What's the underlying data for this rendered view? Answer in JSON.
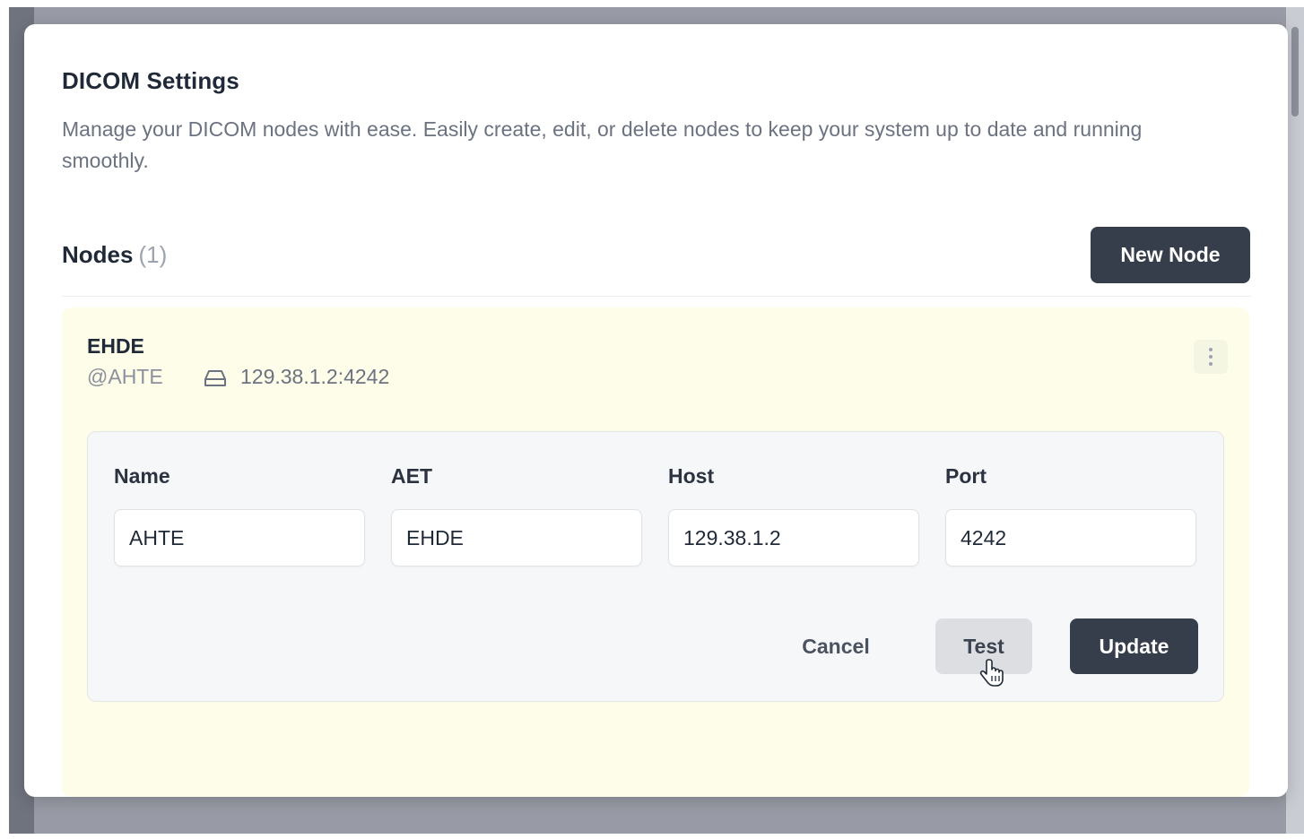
{
  "dialog": {
    "title": "DICOM Settings",
    "description": "Manage your DICOM nodes with ease. Easily create, edit, or delete nodes to keep your system up to date and running smoothly."
  },
  "nodes_section": {
    "heading": "Nodes",
    "count": "(1)",
    "new_button_label": "New Node"
  },
  "node": {
    "name": "EHDE",
    "aet": "@AHTE",
    "address": "129.38.1.2:4242",
    "address_icon": "server-icon",
    "menu_icon": "kebab-menu-icon"
  },
  "edit_form": {
    "name_label": "Name",
    "name_value": "AHTE",
    "aet_label": "AET",
    "aet_value": "EHDE",
    "host_label": "Host",
    "host_value": "129.38.1.2",
    "port_label": "Port",
    "port_value": "4242",
    "cancel_label": "Cancel",
    "test_label": "Test",
    "update_label": "Update"
  },
  "colors": {
    "primary_button": "#363d4b",
    "node_card_background": "#fdfde9",
    "backdrop": "#989ba5"
  },
  "cursor_icon": "hand-pointer-icon"
}
